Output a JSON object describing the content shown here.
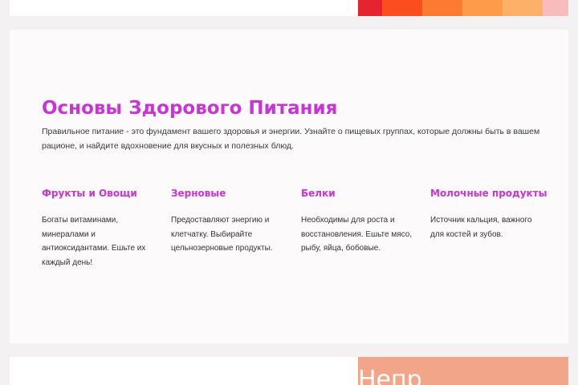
{
  "colors": {
    "accent": "#c934d6",
    "card_bg": "#fcfafb",
    "page_bg": "#f3f1f1",
    "bottom_panel": "#f3a58a",
    "palette": [
      "#e4242f",
      "#fb4d1f",
      "#fd7a32",
      "#fd9b4a",
      "#fcb167",
      "#f9bcbd"
    ]
  },
  "section": {
    "title": "Основы Здорового Питания",
    "intro": "Правильное питание - это фундамент вашего здоровья и энергии. Узнайте о пищевых группах, которые должны быть в вашем рационе, и найдите вдохновение для вкусных и полезных блюд."
  },
  "groups": [
    {
      "title": "Фрукты и Овощи",
      "text": "Богаты витаминами, минералами и антиоксидантами. Ешьте их каждый день!"
    },
    {
      "title": "Зерновые",
      "text": "Предоставляют энергию и клетчатку. Выбирайте цельнозерновые продукты."
    },
    {
      "title": "Белки",
      "text": "Необходимы для роста и восстановления. Ешьте мясо, рыбу, яйца, бобовые."
    },
    {
      "title": "Молочные продукты",
      "text": "Источник кальция, важного для костей и зубов."
    }
  ],
  "bottom_panel": {
    "text": "Непр"
  }
}
